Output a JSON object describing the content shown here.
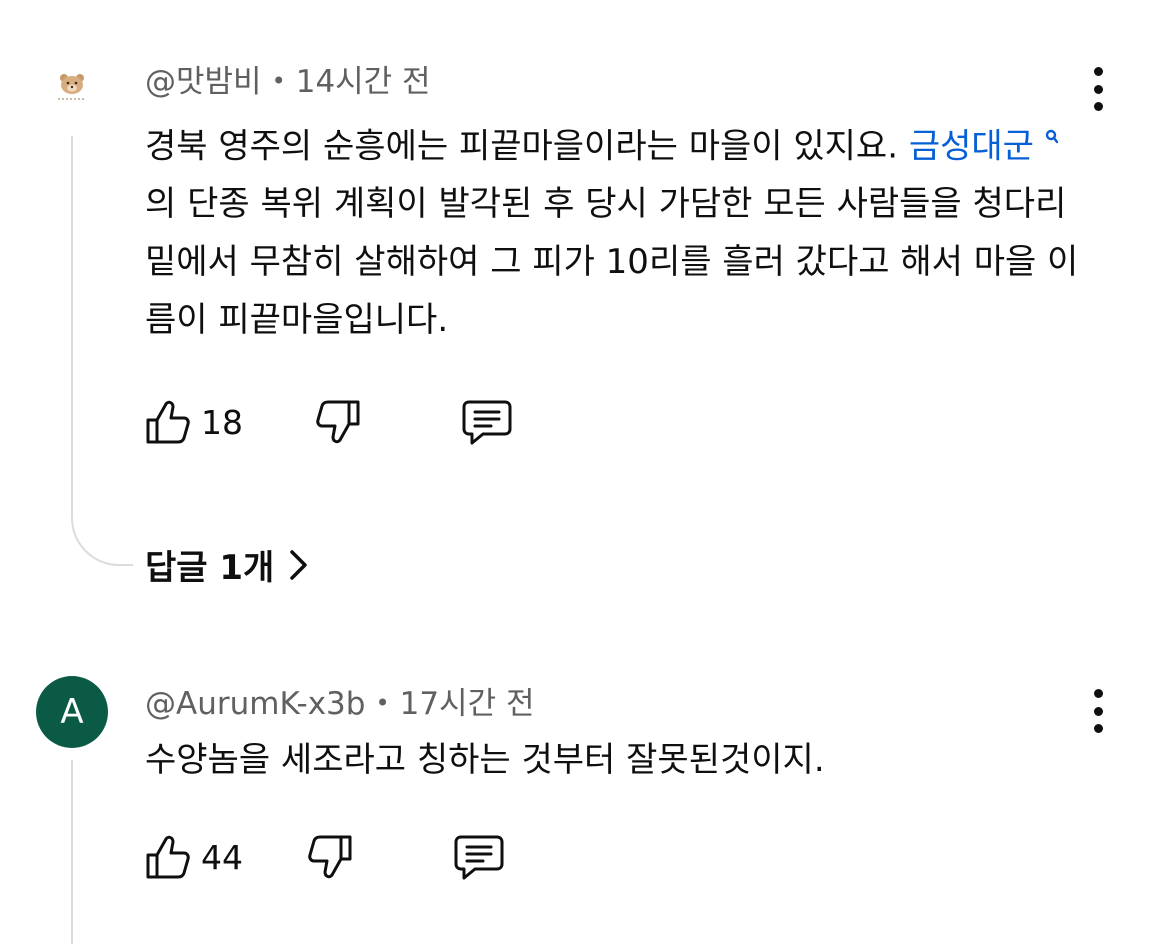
{
  "comments": [
    {
      "author": "@맛밤비",
      "separator": "•",
      "time": "14시간 전",
      "text_before_link": "경북 영주의 순흥에는 피끝마을이라는 마을이 있지요. ",
      "link_text": "금성대군",
      "text_after_link": "의 단종 복위 계획이 발각된 후 당시 가담한 모든 사람들을 청다리 밑에서 무참히 살해하여 그 피가 10리를 흘러 갔다고 해서 마을 이름이 피끝마을입니다.",
      "likes": "18",
      "replies_label": "답글 1개",
      "avatar_icon": "bear-icon"
    },
    {
      "author": "@AurumK-x3b",
      "separator": "•",
      "time": "17시간 전",
      "text": "수양놈을 세조라고 칭하는 것부터 잘못된것이지.",
      "likes": "44",
      "avatar_letter": "A",
      "avatar_color": "#0b5a45"
    }
  ],
  "colors": {
    "link": "#065fd4",
    "meta": "#606060",
    "text": "#0f0f0f"
  },
  "icons": {
    "like": "thumbs-up-icon",
    "dislike": "thumbs-down-icon",
    "reply": "comment-icon",
    "menu": "more-vert-icon",
    "chevron": "chevron-right-icon",
    "search": "search-icon"
  }
}
